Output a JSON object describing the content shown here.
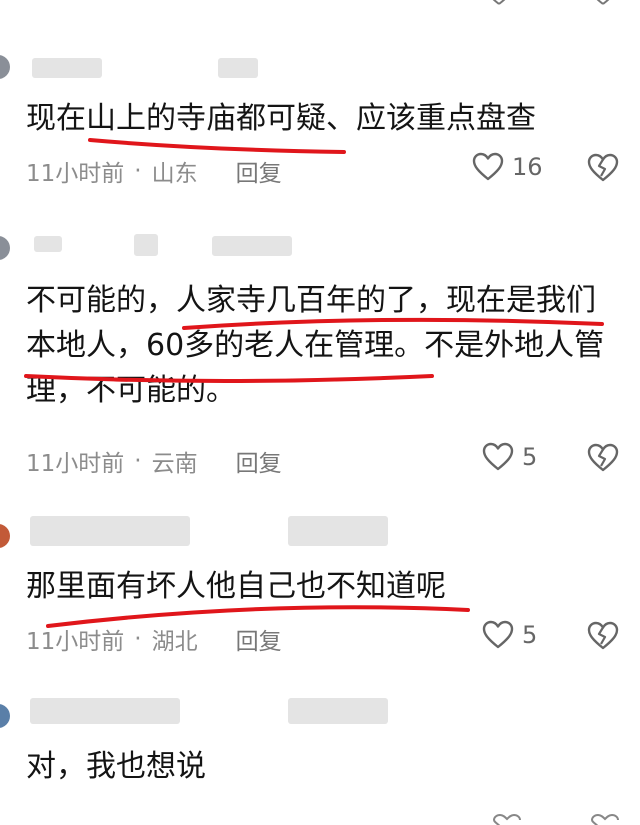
{
  "comments": [
    {
      "text_lines": [
        "现在山上的寺庙都可疑、应该重点盘查"
      ],
      "time": "11小时前",
      "location": "山东",
      "reply": "回复",
      "likes": "16"
    },
    {
      "text_lines": [
        "不可能的，人家寺几百年的了，现在是我们",
        "本地人，60多的老人在管理。不是外地人管",
        "理，不可能的。"
      ],
      "time": "11小时前",
      "location": "云南",
      "reply": "回复",
      "likes": "5"
    },
    {
      "text_lines": [
        "那里面有坏人他自己也不知道呢"
      ],
      "time": "11小时前",
      "location": "湖北",
      "reply": "回复",
      "likes": "5"
    },
    {
      "text_lines": [
        "对，我也想说"
      ]
    }
  ],
  "colors": {
    "underline": "#e0161b",
    "meta": "#8c8c8c",
    "text": "#141414"
  },
  "icons": [
    "heart-outline-icon",
    "broken-heart-icon"
  ]
}
